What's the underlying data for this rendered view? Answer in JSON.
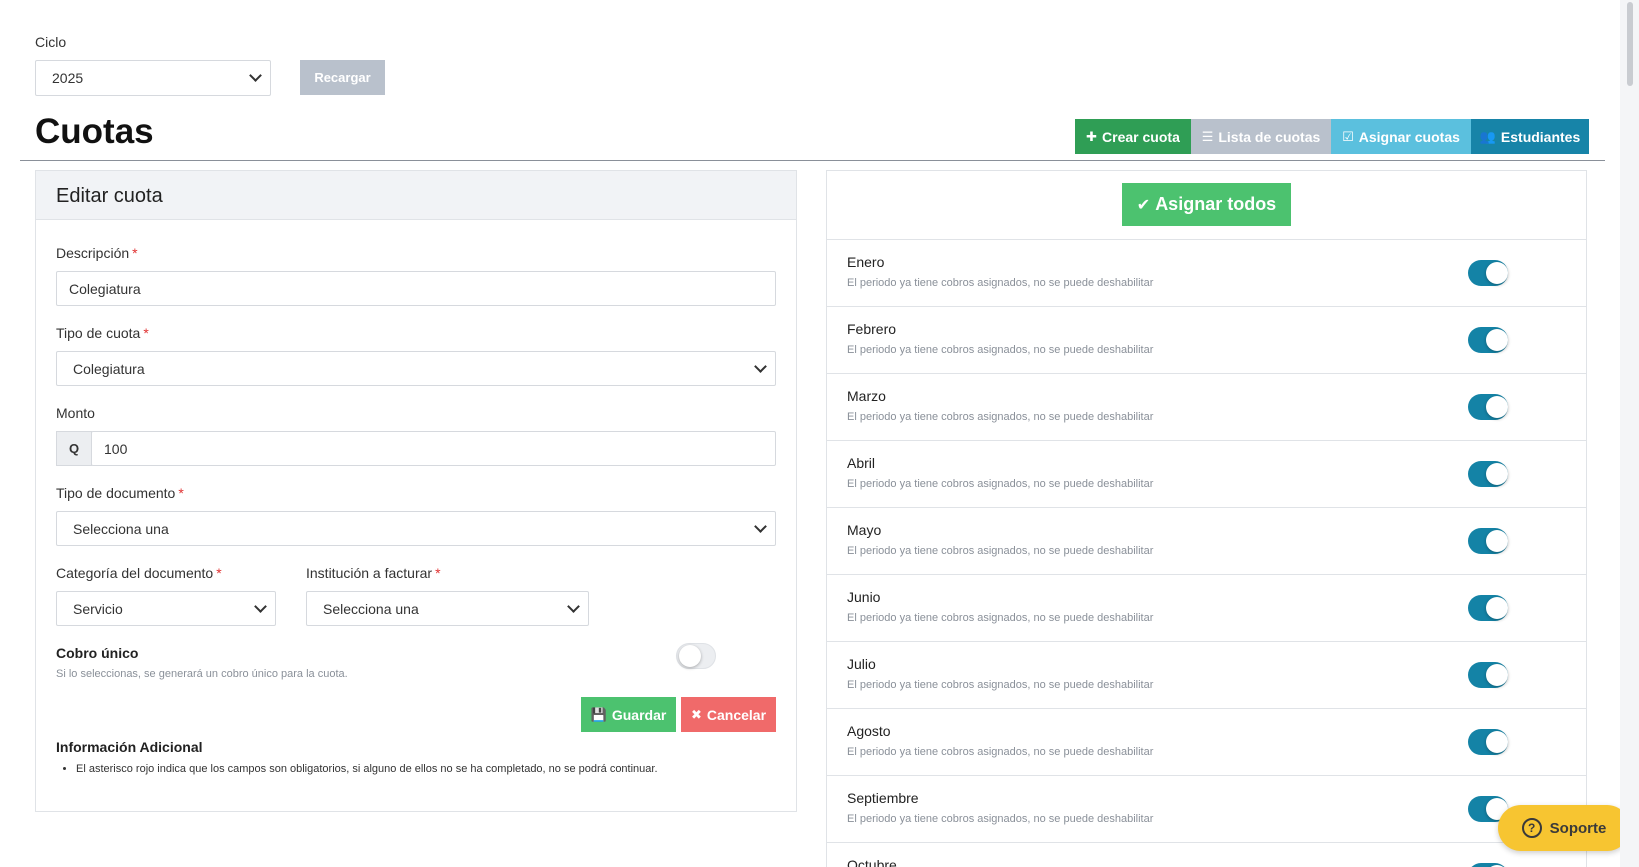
{
  "ciclo": {
    "label": "Ciclo",
    "selected": "2025",
    "reload_label": "Recargar"
  },
  "page_title": "Cuotas",
  "actions": {
    "create": "Crear cuota",
    "list": "Lista de cuotas",
    "assign": "Asignar cuotas",
    "students": "Estudiantes"
  },
  "form": {
    "title": "Editar cuota",
    "descripcion_label": "Descripción",
    "descripcion_value": "Colegiatura",
    "tipo_cuota_label": "Tipo de cuota",
    "tipo_cuota_value": "Colegiatura",
    "monto_label": "Monto",
    "monto_prefix": "Q",
    "monto_value": "100",
    "tipo_documento_label": "Tipo de documento",
    "tipo_documento_value": "Selecciona una",
    "categoria_label": "Categoría del documento",
    "categoria_value": "Servicio",
    "institucion_label": "Institución a facturar",
    "institucion_value": "Selecciona una",
    "cobro_unico_label": "Cobro único",
    "cobro_unico_help": "Si lo seleccionas, se generará un cobro único para la cuota.",
    "cobro_unico_on": false,
    "save_label": "Guardar",
    "cancel_label": "Cancelar",
    "info_title": "Información Adicional",
    "info_items": [
      "El asterisco rojo indica que los campos son obligatorios, si alguno de ellos no se ha completado, no se podrá continuar."
    ]
  },
  "periods": {
    "assign_all_label": "Asignar todos",
    "note": "El periodo ya tiene cobros asignados, no se puede deshabilitar",
    "items": [
      {
        "name": "Enero",
        "enabled": true
      },
      {
        "name": "Febrero",
        "enabled": true
      },
      {
        "name": "Marzo",
        "enabled": true
      },
      {
        "name": "Abril",
        "enabled": true
      },
      {
        "name": "Mayo",
        "enabled": true
      },
      {
        "name": "Junio",
        "enabled": true
      },
      {
        "name": "Julio",
        "enabled": true
      },
      {
        "name": "Agosto",
        "enabled": true
      },
      {
        "name": "Septiembre",
        "enabled": true
      },
      {
        "name": "Octubre",
        "enabled": true
      }
    ]
  },
  "support": {
    "label": "Soporte"
  },
  "colors": {
    "green": "#2f9e55",
    "grey": "#b9c1cc",
    "light_blue": "#5bc0de",
    "dark_teal": "#1784a8",
    "save_green": "#4cc26f",
    "cancel_red": "#f06a6a",
    "toggle_on": "#1483a6",
    "support_yellow": "#f7c531"
  }
}
